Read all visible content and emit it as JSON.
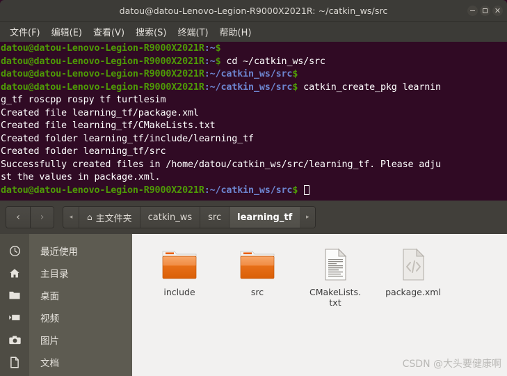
{
  "terminal": {
    "window_title": "datou@datou-Lenovo-Legion-R9000X2021R: ~/catkin_ws/src",
    "window_controls": [
      {
        "name": "minimize",
        "label": "–"
      },
      {
        "name": "maximize",
        "label": "□"
      },
      {
        "name": "close",
        "label": "×"
      }
    ],
    "menu": [
      {
        "label": "文件(F)"
      },
      {
        "label": "编辑(E)"
      },
      {
        "label": "查看(V)"
      },
      {
        "label": "搜索(S)"
      },
      {
        "label": "终端(T)"
      },
      {
        "label": "帮助(H)"
      }
    ],
    "colors": {
      "background": "#300a24",
      "prompt_user": "#4e9a06",
      "prompt_path": "#6d85cf",
      "text": "#ffffff",
      "chrome": "#3c3b37"
    },
    "lines": [
      {
        "user": "datou@datou-Lenovo-Legion-R9000X2021R",
        "path": ":~",
        "prompt": "$",
        "cmd": ""
      },
      {
        "user": "datou@datou-Lenovo-Legion-R9000X2021R",
        "path": ":~",
        "prompt": "$",
        "cmd": " cd ~/catkin_ws/src"
      },
      {
        "user": "datou@datou-Lenovo-Legion-R9000X2021R",
        "path": ":~/catkin_ws/src",
        "prompt": "$",
        "cmd": ""
      },
      {
        "user": "datou@datou-Lenovo-Legion-R9000X2021R",
        "path": ":~/catkin_ws/src",
        "prompt": "$",
        "cmd": " catkin_create_pkg learnin"
      },
      {
        "output": "g_tf roscpp rospy tf turtlesim"
      },
      {
        "output": "Created file learning_tf/package.xml"
      },
      {
        "output": "Created file learning_tf/CMakeLists.txt"
      },
      {
        "output": "Created folder learning_tf/include/learning_tf"
      },
      {
        "output": "Created folder learning_tf/src"
      },
      {
        "output": "Successfully created files in /home/datou/catkin_ws/src/learning_tf. Please adju"
      },
      {
        "output": "st the values in package.xml."
      },
      {
        "user": "datou@datou-Lenovo-Legion-R9000X2021R",
        "path": ":~/catkin_ws/src",
        "prompt": "$",
        "cmd": " ",
        "cursor": true
      }
    ]
  },
  "filemanager": {
    "nav": {
      "back_label": "‹",
      "forward_label": "›",
      "path_scroll_left_label": "◂",
      "path_scroll_right_label": "▸"
    },
    "breadcrumbs": [
      {
        "label": "主文件夹",
        "icon": "home-icon",
        "active": false
      },
      {
        "label": "catkin_ws",
        "active": false
      },
      {
        "label": "src",
        "active": false
      },
      {
        "label": "learning_tf",
        "active": true
      }
    ],
    "sidebar": [
      {
        "label": "最近使用",
        "icon": "clock-icon"
      },
      {
        "label": "主目录",
        "icon": "home-icon"
      },
      {
        "label": "桌面",
        "icon": "folder-icon"
      },
      {
        "label": "视频",
        "icon": "video-icon"
      },
      {
        "label": "图片",
        "icon": "camera-icon"
      },
      {
        "label": "文档",
        "icon": "document-icon"
      }
    ],
    "files": [
      {
        "name": "include",
        "type": "folder"
      },
      {
        "name": "src",
        "type": "folder"
      },
      {
        "name": "CMakeLists.\ntxt",
        "type": "text-file"
      },
      {
        "name": "package.xml",
        "type": "code-file"
      }
    ],
    "colors": {
      "folder": "#e8600f",
      "pathbar": "#413f3a",
      "sidebar": "#5d5b51",
      "content_bg": "#f2f1f0"
    }
  },
  "watermark": {
    "text": "CSDN @大头要健康啊"
  }
}
